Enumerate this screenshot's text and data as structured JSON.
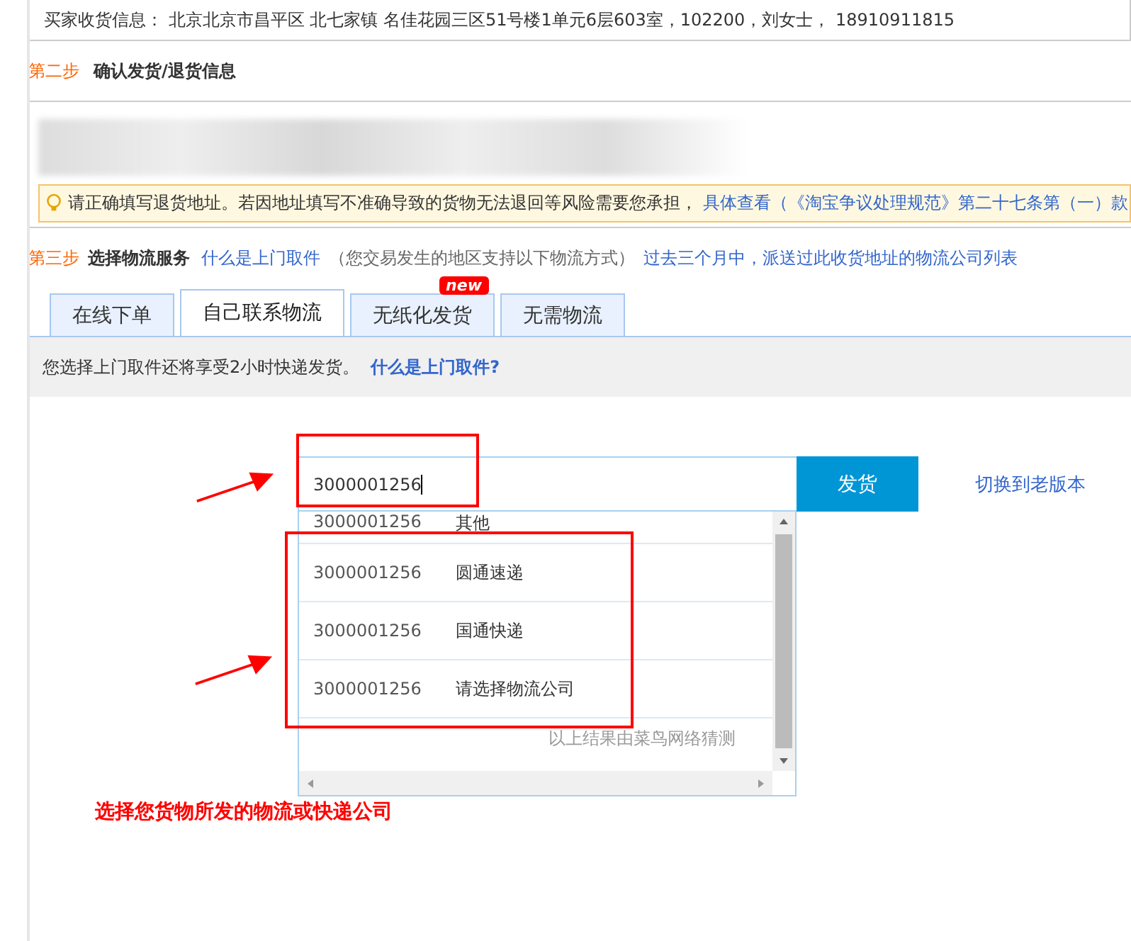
{
  "buyer_address": "买家收货信息： 北京北京市昌平区 北七家镇 名佳花园三区51号楼1单元6层603室，102200，刘女士， 18910911815",
  "step2": {
    "step": "第二步",
    "title": "确认发货/退货信息",
    "notice": "请正确填写退货地址。若因地址填写不准确导致的货物无法退回等风险需要您承担，",
    "notice_link": "具体查看（《淘宝争议处理规范》第二十七条第（一）款"
  },
  "step3": {
    "step": "第三步",
    "title": "选择物流服务",
    "link": "什么是上门取件",
    "hint": "（您交易发生的地区支持以下物流方式）",
    "link2": "过去三个月中，派送过此收货地址的物流公司列表"
  },
  "tabs": [
    {
      "label": "在线下单",
      "selected": false
    },
    {
      "label": "自己联系物流",
      "selected": true
    },
    {
      "label": "无纸化发货",
      "selected": false,
      "badge": "new"
    },
    {
      "label": "无需物流",
      "selected": false
    }
  ],
  "info": {
    "text": "您选择上门取件还将享受2小时快递发货。",
    "link": "什么是上门取件?"
  },
  "tracking_field": {
    "value": "3000001256"
  },
  "ship_button": "发货",
  "switch_link": "切换到老版本",
  "suggestions": [
    {
      "number": "3000001256",
      "company": "其他"
    },
    {
      "number": "3000001256",
      "company": "圆通速递"
    },
    {
      "number": "3000001256",
      "company": "国通快递"
    },
    {
      "number": "3000001256",
      "company": "请选择物流公司"
    }
  ],
  "suggestion_note": "以上结果由菜鸟网络猜测",
  "annotation": "选择您货物所发的物流或快递公司"
}
